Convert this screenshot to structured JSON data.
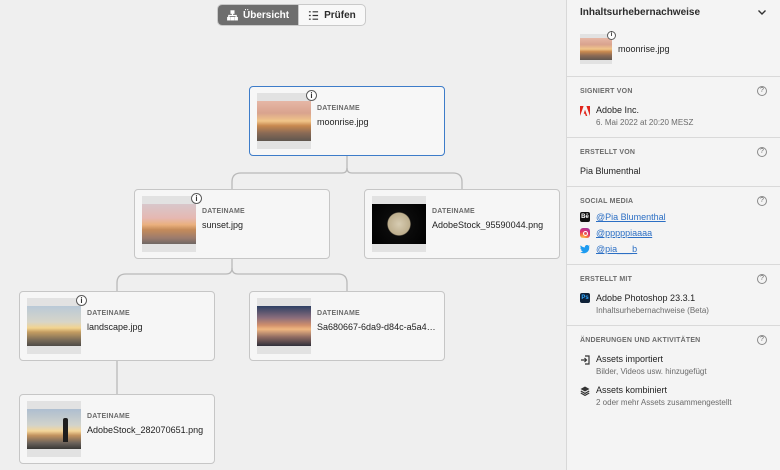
{
  "toolbar": {
    "overview_label": "Übersicht",
    "check_label": "Prüfen"
  },
  "graph": {
    "label": "DATEINAME",
    "nodes": [
      {
        "filename": "moonrise.jpg",
        "image": "sunset-orange",
        "info": "i"
      },
      {
        "filename": "sunset.jpg",
        "image": "sunset-pink",
        "info": "i"
      },
      {
        "filename": "AdobeStock_95590044.png",
        "image": "moon"
      },
      {
        "filename": "landscape.jpg",
        "image": "landscape",
        "info": "i"
      },
      {
        "filename": "Sa680667-6da9-d84c-a5a4-bc...",
        "image": "sky"
      },
      {
        "filename": "AdobeStock_282070651.png",
        "image": "person-silhouette"
      }
    ]
  },
  "panel": {
    "title": "Inhaltsurhebernachweise",
    "file": {
      "name": "moonrise.jpg",
      "info": "i"
    },
    "help_glyph": "?",
    "signed_by": {
      "title": "SIGNIERT VON",
      "name": "Adobe Inc.",
      "date": "6. Mai 2022 at 20:20 MESZ",
      "icon": "adobe-logo-icon"
    },
    "created_by": {
      "title": "ERSTELLT VON",
      "name": "Pia Blumenthal"
    },
    "social": {
      "title": "SOCIAL MEDIA",
      "behance_glyph": "Bē",
      "items": [
        {
          "network": "behance",
          "handle": "@Pia Blumenthal"
        },
        {
          "network": "instagram",
          "handle": "@pppppiaaaa"
        },
        {
          "network": "twitter",
          "handle": "@pia___b"
        }
      ]
    },
    "created_with": {
      "title": "ERSTELLT MIT",
      "app_glyph": "Ps",
      "app": "Adobe Photoshop 23.3.1",
      "detail": "Inhaltsurhebernachweise (Beta)"
    },
    "activity": {
      "title": "ÄNDERUNGEN UND AKTIVITÄTEN",
      "items": [
        {
          "icon": "import-icon",
          "title": "Assets importiert",
          "detail": "Bilder, Videos usw. hinzugefügt"
        },
        {
          "icon": "layers-icon",
          "title": "Assets kombiniert",
          "detail": "2 oder mehr Assets zusammengestellt"
        }
      ]
    }
  },
  "colors": {
    "selected_border": "#3d7cc9",
    "link": "#2c6fc4",
    "adobe_red": "#e1251b"
  }
}
